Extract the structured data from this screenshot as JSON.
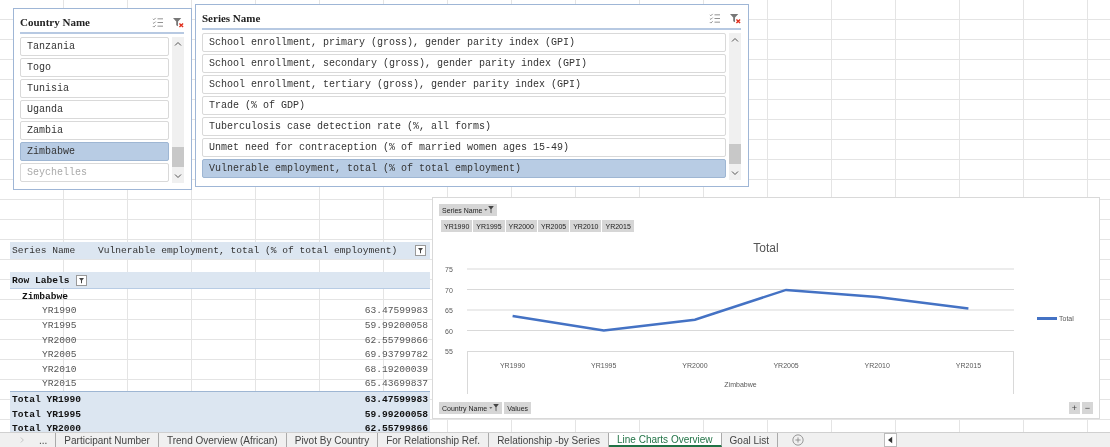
{
  "slicers": [
    {
      "title": "Country Name",
      "items": [
        {
          "label": "Tanzania",
          "selected": false,
          "available": true
        },
        {
          "label": "Togo",
          "selected": false,
          "available": true
        },
        {
          "label": "Tunisia",
          "selected": false,
          "available": true
        },
        {
          "label": "Uganda",
          "selected": false,
          "available": true
        },
        {
          "label": "Zambia",
          "selected": false,
          "available": true
        },
        {
          "label": "Zimbabwe",
          "selected": true,
          "available": true
        },
        {
          "label": "Seychelles",
          "selected": false,
          "available": false
        }
      ]
    },
    {
      "title": "Series Name",
      "items": [
        {
          "label": "School enrollment, primary (gross), gender parity index (GPI)",
          "selected": false,
          "available": true
        },
        {
          "label": "School enrollment, secondary (gross), gender parity index (GPI)",
          "selected": false,
          "available": true
        },
        {
          "label": "School enrollment, tertiary (gross), gender parity index (GPI)",
          "selected": false,
          "available": true
        },
        {
          "label": "Trade (% of GDP)",
          "selected": false,
          "available": true
        },
        {
          "label": "Tuberculosis case detection rate (%, all forms)",
          "selected": false,
          "available": true
        },
        {
          "label": "Unmet need for contraception (% of married women ages 15-49)",
          "selected": false,
          "available": true
        },
        {
          "label": "Vulnerable employment, total (% of total employment)",
          "selected": true,
          "available": true
        }
      ]
    }
  ],
  "pivot": {
    "filter_label": "Series Name",
    "filter_value": "Vulnerable employment, total (% of total employment)",
    "row_labels_header": "Row Labels",
    "group": "Zimbabwe",
    "rows": [
      {
        "label": "YR1990",
        "value": "63.47599983"
      },
      {
        "label": "YR1995",
        "value": "59.99200058"
      },
      {
        "label": "YR2000",
        "value": "62.55799866"
      },
      {
        "label": "YR2005",
        "value": "69.93799782"
      },
      {
        "label": "YR2010",
        "value": "68.19200039"
      },
      {
        "label": "YR2015",
        "value": "65.43699837"
      }
    ],
    "totals": [
      {
        "label": "Total YR1990",
        "value": "63.47599983"
      },
      {
        "label": "Total YR1995",
        "value": "59.99200058"
      },
      {
        "label": "Total YR2000",
        "value": "62.55799866"
      }
    ]
  },
  "chart": {
    "filter_button": "Series Name",
    "legend_buttons": [
      "YR1990",
      "YR1995",
      "YR2000",
      "YR2005",
      "YR2010",
      "YR2015"
    ],
    "axis_button": "Country Name",
    "values_button": "Values",
    "zoom_in": "+",
    "zoom_out": "−",
    "chart_data": {
      "type": "line",
      "title": "Total",
      "xlabel": "Zimbabwe",
      "categories": [
        "YR1990",
        "YR1995",
        "YR2000",
        "YR2005",
        "YR2010",
        "YR2015"
      ],
      "series": [
        {
          "name": "Total",
          "color": "#4472c4",
          "values": [
            63.5,
            60.0,
            62.6,
            69.9,
            68.2,
            65.4
          ]
        }
      ],
      "grid": true,
      "ylim": [
        55,
        75
      ],
      "yticks": [
        55,
        60,
        65,
        70,
        75
      ]
    }
  },
  "sheet_tabs": [
    {
      "label": "...",
      "selected": false
    },
    {
      "label": "Participant Number",
      "selected": false
    },
    {
      "label": "Trend Overview (African)",
      "selected": false
    },
    {
      "label": "Pivot By Country",
      "selected": false
    },
    {
      "label": "For Relationship Ref.",
      "selected": false
    },
    {
      "label": "Relationship -by Series",
      "selected": false
    },
    {
      "label": "Line Charts Overview",
      "selected": true
    },
    {
      "label": "Goal List",
      "selected": false
    }
  ]
}
